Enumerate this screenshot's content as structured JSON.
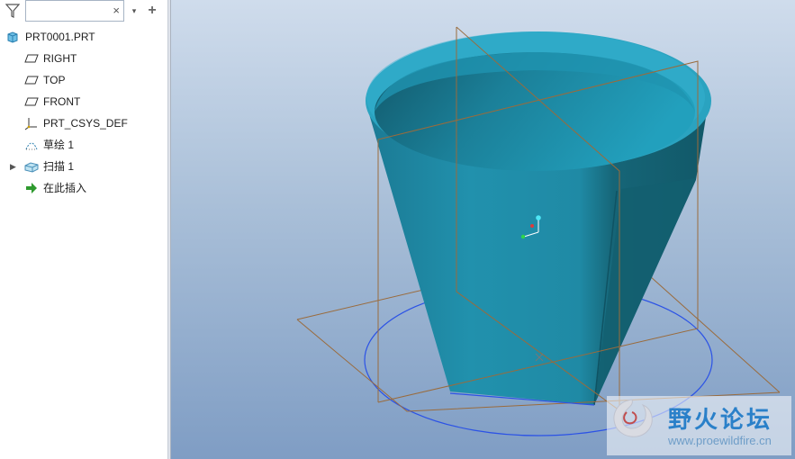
{
  "search": {
    "value": "",
    "clear_glyph": "×"
  },
  "toolbar": {
    "filter_icon": "filter-icon",
    "dropdown_glyph": "▾",
    "add_glyph": "+"
  },
  "model_tree": {
    "items": [
      {
        "label": "PRT0001.PRT",
        "icon": "part-icon",
        "expandable": false
      },
      {
        "label": "RIGHT",
        "icon": "datum-plane-icon",
        "expandable": false
      },
      {
        "label": "TOP",
        "icon": "datum-plane-icon",
        "expandable": false
      },
      {
        "label": "FRONT",
        "icon": "datum-plane-icon",
        "expandable": false
      },
      {
        "label": "PRT_CSYS_DEF",
        "icon": "csys-icon",
        "expandable": false
      },
      {
        "label": "草绘 1",
        "icon": "sketch-icon",
        "expandable": false
      },
      {
        "label": "扫描 1",
        "icon": "sweep-icon",
        "expandable": true
      },
      {
        "label": "在此插入",
        "icon": "insert-here-arrow-icon",
        "expandable": false
      }
    ]
  },
  "watermark": {
    "title": "野火论坛",
    "url": "www.proewildfire.cn"
  },
  "colors": {
    "model": "#1f8faa",
    "datum_plane": "#9a6b3c",
    "sketch": "#2b52e6",
    "background_top": "#cfdcec",
    "background_bottom": "#7f9dc4",
    "insert_arrow": "#2e9a2e"
  }
}
